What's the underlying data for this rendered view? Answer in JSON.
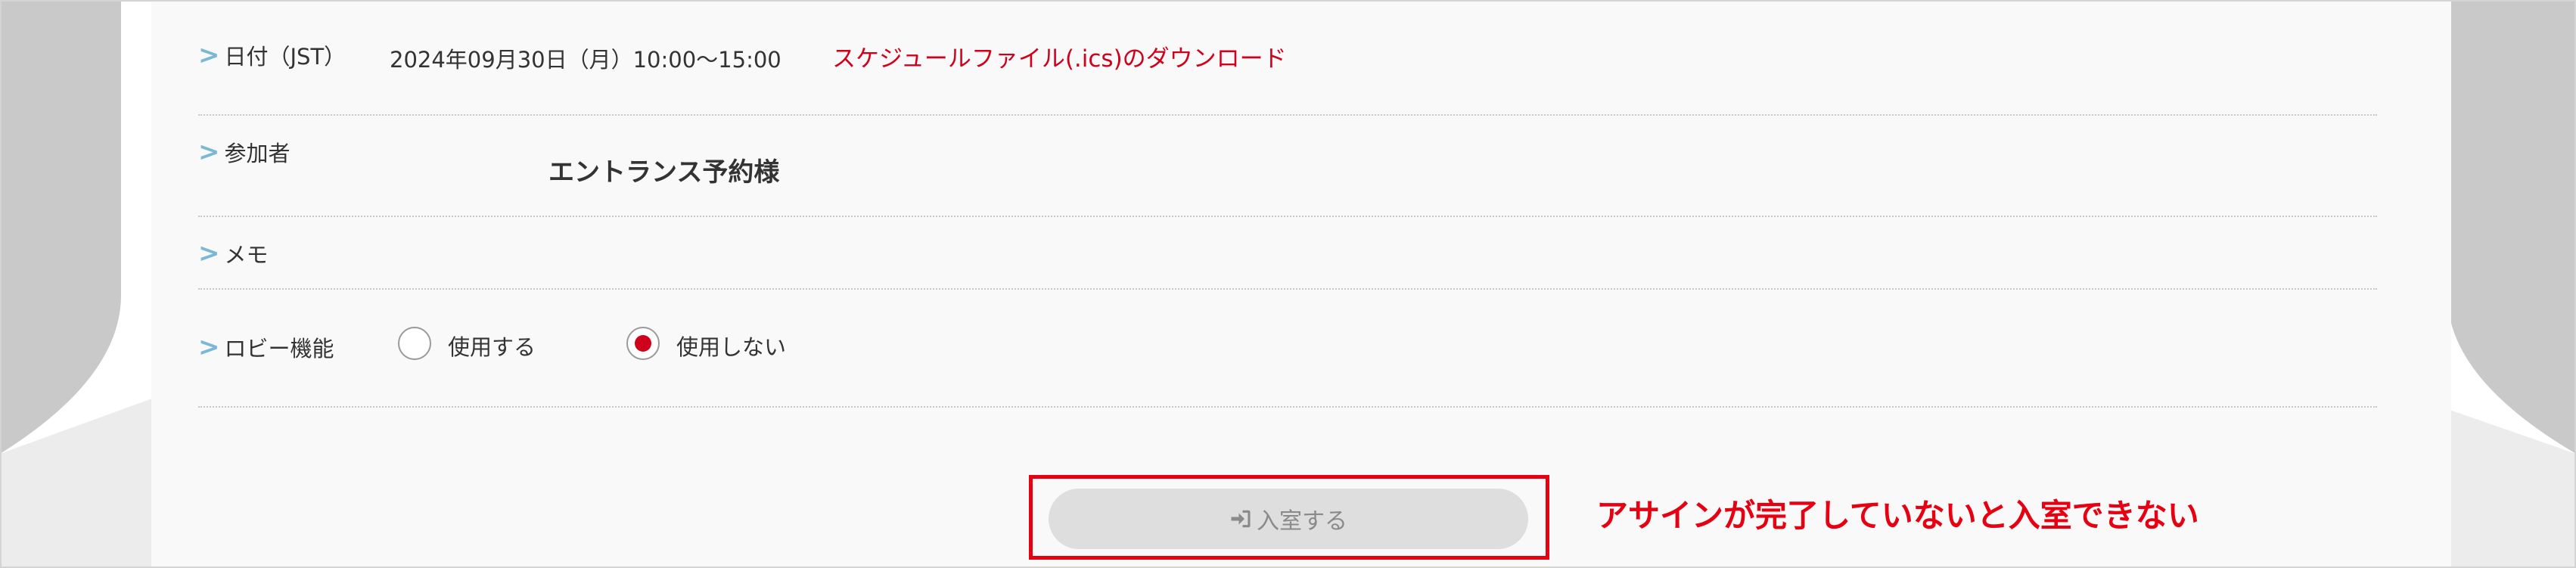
{
  "rows": {
    "date": {
      "label": "日付（JST）",
      "value": "2024年09月30日（月）10:00〜15:00",
      "ics_link": "スケジュールファイル(.ics)のダウンロード"
    },
    "participants": {
      "label": "参加者",
      "value": "エントランス予約様"
    },
    "memo": {
      "label": "メモ",
      "value": ""
    },
    "lobby": {
      "label": "ロビー機能",
      "options": [
        {
          "label": "使用する",
          "checked": false
        },
        {
          "label": "使用しない",
          "checked": true
        }
      ]
    }
  },
  "enter_button": {
    "label": "入室する",
    "icon": "sign-in-icon",
    "disabled": true
  },
  "annotation": "アサインが完了していないと入室できない",
  "colors": {
    "accent_red": "#d0021b",
    "annotation_red": "#e60012",
    "chevron": "#7ab8d6",
    "button_disabled_bg": "#dedede"
  }
}
